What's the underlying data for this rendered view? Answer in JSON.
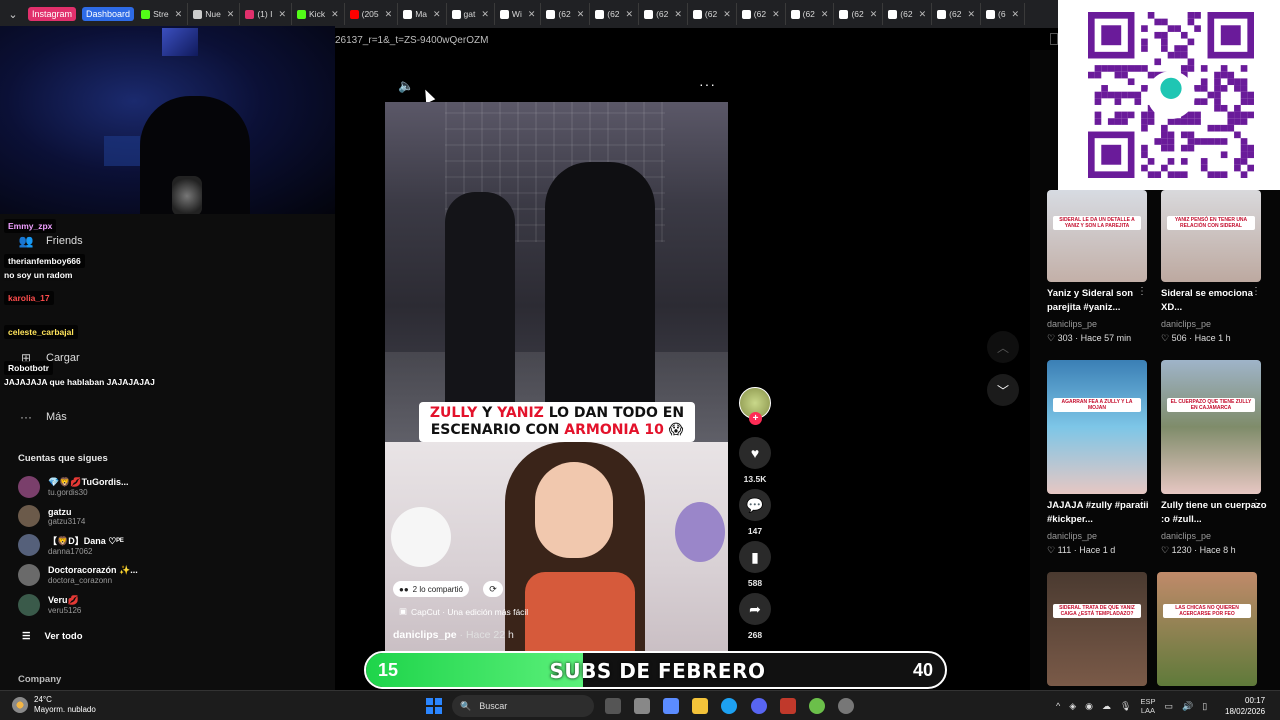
{
  "browser": {
    "pinned_tabs": [
      {
        "label": "Instagram",
        "color": "#e1306c"
      },
      {
        "label": "Dashboard",
        "color": "#2e6be6"
      }
    ],
    "tabs": [
      {
        "label": "Stre",
        "icon": "green-k-icon",
        "color": "#53fc18"
      },
      {
        "label": "Nue",
        "icon": "doc-icon",
        "color": "#cccccc"
      },
      {
        "label": "(1) I",
        "icon": "instagram-icon",
        "color": "#e1306c"
      },
      {
        "label": "Kick",
        "icon": "green-k-icon",
        "color": "#53fc18"
      },
      {
        "label": "(205",
        "icon": "youtube-icon",
        "color": "#ff0000"
      },
      {
        "label": "Ma",
        "icon": "tiktok-icon",
        "color": "#ffffff"
      },
      {
        "label": "gat",
        "icon": "tiktok-icon",
        "color": "#ffffff"
      },
      {
        "label": "Wi",
        "icon": "wiki-icon",
        "color": "#ffffff"
      },
      {
        "label": "(62",
        "icon": "tiktok-icon",
        "color": "#ffffff"
      },
      {
        "label": "(62",
        "icon": "tiktok-icon",
        "color": "#ffffff"
      },
      {
        "label": "(62",
        "icon": "tiktok-icon",
        "color": "#ffffff"
      },
      {
        "label": "(62",
        "icon": "tiktok-icon",
        "color": "#ffffff"
      },
      {
        "label": "(62",
        "icon": "tiktok-icon",
        "color": "#ffffff"
      },
      {
        "label": "(62",
        "icon": "tiktok-icon",
        "color": "#ffffff"
      },
      {
        "label": "(62",
        "icon": "tiktok-icon",
        "color": "#ffffff"
      },
      {
        "label": "(62",
        "icon": "tiktok-icon",
        "color": "#ffffff"
      },
      {
        "label": "(62",
        "icon": "tiktok-icon",
        "color": "#ffffff"
      },
      {
        "label": "(6",
        "icon": "tiktok-icon",
        "color": "#ffffff"
      }
    ],
    "url": "26137_r=1&_t=ZS-9400wQerOZM"
  },
  "sidebar": {
    "nav": [
      {
        "label": "Friends",
        "icon": "friends-icon"
      },
      {
        "label": "Cargar",
        "icon": "upload-icon"
      },
      {
        "label": "Más",
        "icon": "more-icon"
      }
    ],
    "chat": [
      {
        "user": "Emmy_zpx",
        "color": "#f0a0ff",
        "message": ""
      },
      {
        "user": "therianfemboy666",
        "color": "#ffffff",
        "message": "no soy un radom"
      },
      {
        "user": "karolia_17",
        "color": "#ff4d4d",
        "message": ""
      },
      {
        "user": "celeste_carbajal",
        "color": "#ffe45c",
        "message": ""
      },
      {
        "user": "Robotbotr",
        "color": "#ffffff",
        "message": "JAJAJAJA que hablaban JAJAJAJAJ"
      }
    ],
    "following_title": "Cuentas que sigues",
    "following": [
      {
        "name": "💎🦁💋TuGordis...",
        "handle": "tu.gordis30",
        "color": "#7a3f6b"
      },
      {
        "name": "gatzu",
        "handle": "gatzu3174",
        "color": "#6b5a4a"
      },
      {
        "name": "【🦁D】Dana ♡ᴾᴱ",
        "handle": "danna17062",
        "color": "#55607a"
      },
      {
        "name": "Doctoracorazón ✨...",
        "handle": "doctora_corazonn",
        "color": "#6a6a6a"
      },
      {
        "name": "Veru💋",
        "handle": "veru5126",
        "color": "#3a5a4a"
      }
    ],
    "see_all": "Ver todo",
    "company": "Company"
  },
  "video": {
    "caption_parts": [
      {
        "text": "ZULLY",
        "red": true
      },
      {
        "text": " Y ",
        "red": false
      },
      {
        "text": "YANIZ",
        "red": true
      },
      {
        "text": " LO DAN TODO EN ESCENARIO CON ",
        "red": false
      },
      {
        "text": "ARMONIA 10",
        "red": true
      },
      {
        "text": " 😱",
        "red": false
      }
    ],
    "shared": "2 lo compartió",
    "capcut": "CapCut · Una edición más fácil",
    "author": "daniclips_pe",
    "time": " · Hace 22 h",
    "likes": "13.5K",
    "comments": "147",
    "saves": "588",
    "shares": "268"
  },
  "recommended": [
    {
      "caption": "Yaniz y Sideral son parejita #yaniz...",
      "author": "daniclips_pe",
      "stats": "♡ 303 · Hace 57 min",
      "label": "SIDERAL LE DA UN DETALLE A YANIZ Y SON LA PAREJITA"
    },
    {
      "caption": "Sideral se emociona XD...",
      "author": "daniclips_pe",
      "stats": "♡ 506 · Hace 1 h",
      "label": "YANIZ PENSÓ EN TENER UNA RELACIÓN CON SIDERAL"
    },
    {
      "caption": "JAJAJA #zully #paratii #kickper...",
      "author": "daniclips_pe",
      "stats": "♡ 111 · Hace 1 d",
      "label": "AGARRAN FEA A ZULLY Y LA MOJAN"
    },
    {
      "caption": "Zully tiene un cuerpazo :o #zull...",
      "author": "daniclips_pe",
      "stats": "♡ 1230 · Hace 8 h",
      "label": "EL CUERPAZO QUE TIENE ZULLY EN CAJAMARCA"
    },
    {
      "caption": "",
      "author": "",
      "stats": "",
      "label": "SIDERAL TRATA DE QUE YANIZ CAIGA ¿ESTÁ TEMPLADAZO?"
    },
    {
      "caption": "",
      "author": "",
      "stats": "",
      "label": "LAS CHICAS NO QUIEREN ACERCARSE POR FEO"
    }
  ],
  "subs": {
    "current": "15",
    "title": "SUBS DE FEBRERO",
    "goal": "40",
    "progress_fraction": 0.375,
    "fill_color": "#1ed44a"
  },
  "taskbar": {
    "temp": "24°C",
    "weather": "Mayorm. nublado",
    "search": "Buscar",
    "lang1": "ESP",
    "lang2": "LAA",
    "time": "00:17",
    "date": "18/02/2026"
  }
}
